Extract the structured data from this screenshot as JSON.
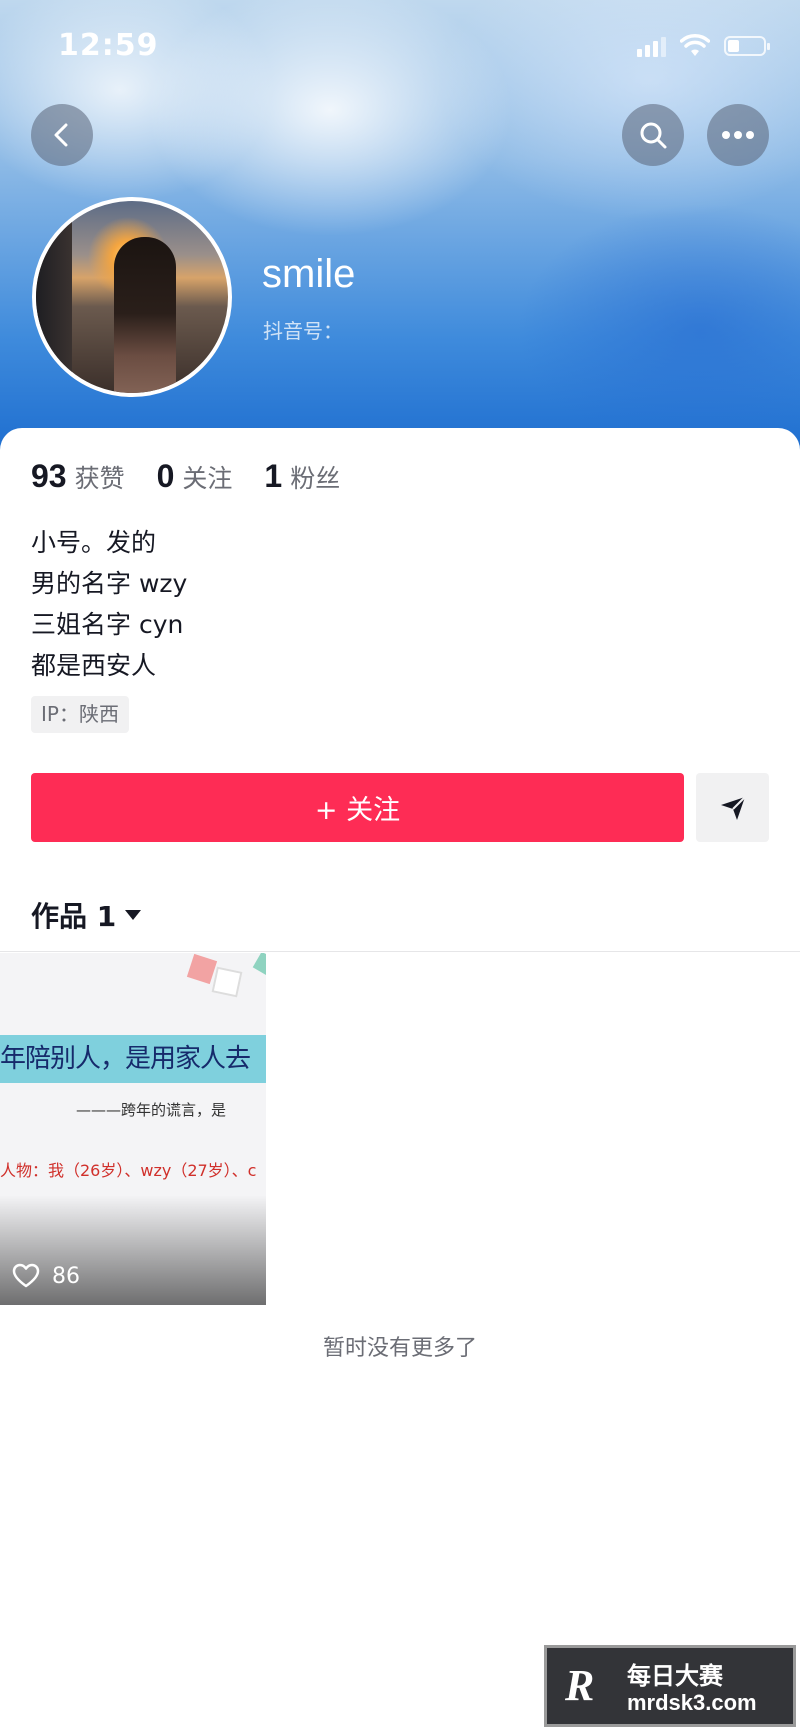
{
  "status_bar": {
    "time": "12:59"
  },
  "profile": {
    "nickname": "smile",
    "douyin_id_label": "抖音号："
  },
  "stats": [
    {
      "value": "93",
      "label": "获赞"
    },
    {
      "value": "0",
      "label": "关注"
    },
    {
      "value": "1",
      "label": "粉丝"
    }
  ],
  "bio": [
    "小号。发的",
    "男的名字 wzy",
    "三姐名字 cyn",
    "都是西安人"
  ],
  "ip_tag": "IP：陕西",
  "actions": {
    "follow_label": "+ 关注"
  },
  "tabs": {
    "works_label": "作品 1"
  },
  "video": {
    "caption_main": "年陪别人，是用家人去",
    "caption_sub": "———跨年的谎言，是",
    "caption_red": "人物：我（26岁）、wzy（27岁）、c",
    "likes": "86"
  },
  "footer": {
    "no_more": "暂时没有更多了"
  },
  "watermark": {
    "logo": "R",
    "cn": "每日大赛",
    "url": "mrdsk3.com"
  },
  "colors": {
    "accent": "#fe2c55",
    "banner": "#3f8bdc"
  }
}
